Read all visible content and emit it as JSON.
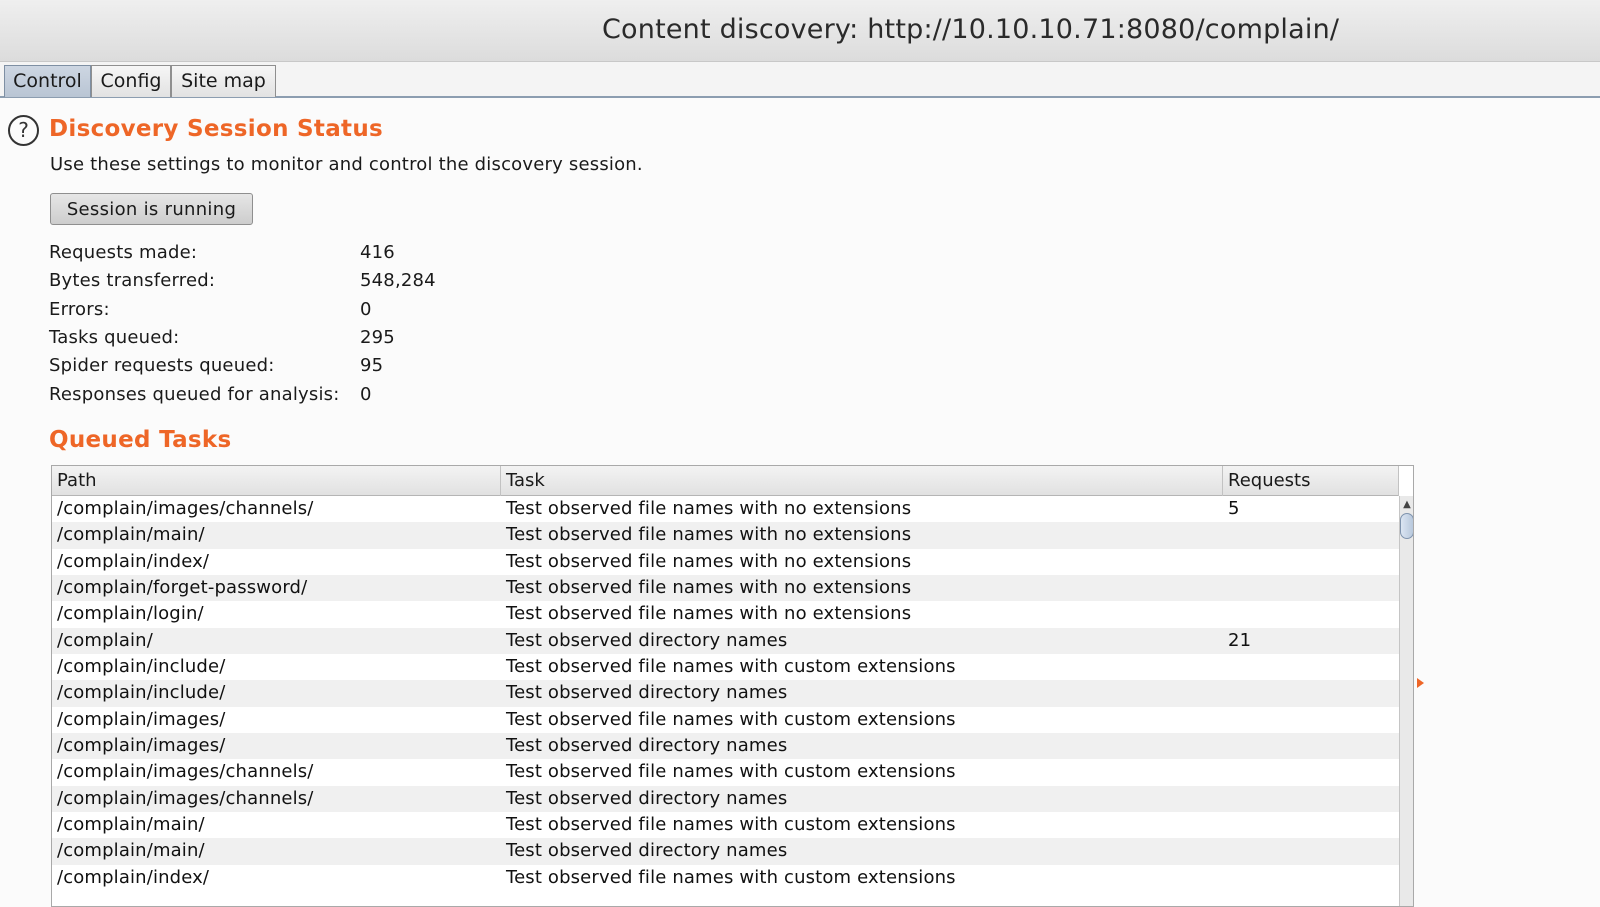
{
  "window": {
    "title": "Content discovery: http://10.10.10.71:8080/complain/"
  },
  "tabs": [
    {
      "label": "Control",
      "active": true
    },
    {
      "label": "Config",
      "active": false
    },
    {
      "label": "Site map",
      "active": false
    }
  ],
  "status": {
    "help_glyph": "?",
    "title": "Discovery Session Status",
    "description": "Use these settings to monitor and control the discovery session.",
    "session_button_label": "Session is running",
    "stats": [
      {
        "label": "Requests made:",
        "value": "416"
      },
      {
        "label": "Bytes transferred:",
        "value": "548,284"
      },
      {
        "label": "Errors:",
        "value": "0"
      },
      {
        "label": "Tasks queued:",
        "value": "295"
      },
      {
        "label": "Spider requests queued:",
        "value": "95"
      },
      {
        "label": "Responses queued for analysis:",
        "value": "0"
      }
    ]
  },
  "queued_tasks": {
    "title": "Queued Tasks",
    "columns": [
      "Path",
      "Task",
      "Requests"
    ],
    "rows": [
      {
        "path": "/complain/images/channels/",
        "task": "Test observed file names with no extensions",
        "requests": "5"
      },
      {
        "path": "/complain/main/",
        "task": "Test observed file names with no extensions",
        "requests": ""
      },
      {
        "path": "/complain/index/",
        "task": "Test observed file names with no extensions",
        "requests": ""
      },
      {
        "path": "/complain/forget-password/",
        "task": "Test observed file names with no extensions",
        "requests": ""
      },
      {
        "path": "/complain/login/",
        "task": "Test observed file names with no extensions",
        "requests": ""
      },
      {
        "path": "/complain/",
        "task": "Test observed directory names",
        "requests": "21"
      },
      {
        "path": "/complain/include/",
        "task": "Test observed file names with custom extensions",
        "requests": ""
      },
      {
        "path": "/complain/include/",
        "task": "Test observed directory names",
        "requests": ""
      },
      {
        "path": "/complain/images/",
        "task": "Test observed file names with custom extensions",
        "requests": ""
      },
      {
        "path": "/complain/images/",
        "task": "Test observed directory names",
        "requests": ""
      },
      {
        "path": "/complain/images/channels/",
        "task": "Test observed file names with custom extensions",
        "requests": ""
      },
      {
        "path": "/complain/images/channels/",
        "task": "Test observed directory names",
        "requests": ""
      },
      {
        "path": "/complain/main/",
        "task": "Test observed file names with custom extensions",
        "requests": ""
      },
      {
        "path": "/complain/main/",
        "task": "Test observed directory names",
        "requests": ""
      },
      {
        "path": "/complain/index/",
        "task": "Test observed file names with custom extensions",
        "requests": ""
      }
    ]
  },
  "colors": {
    "accent": "#ee6627",
    "tab_active": "#c3cedc"
  },
  "icons": {
    "help": "help-icon",
    "scroll_up": "scroll-up-arrow-icon",
    "expand": "expand-arrow-icon"
  }
}
